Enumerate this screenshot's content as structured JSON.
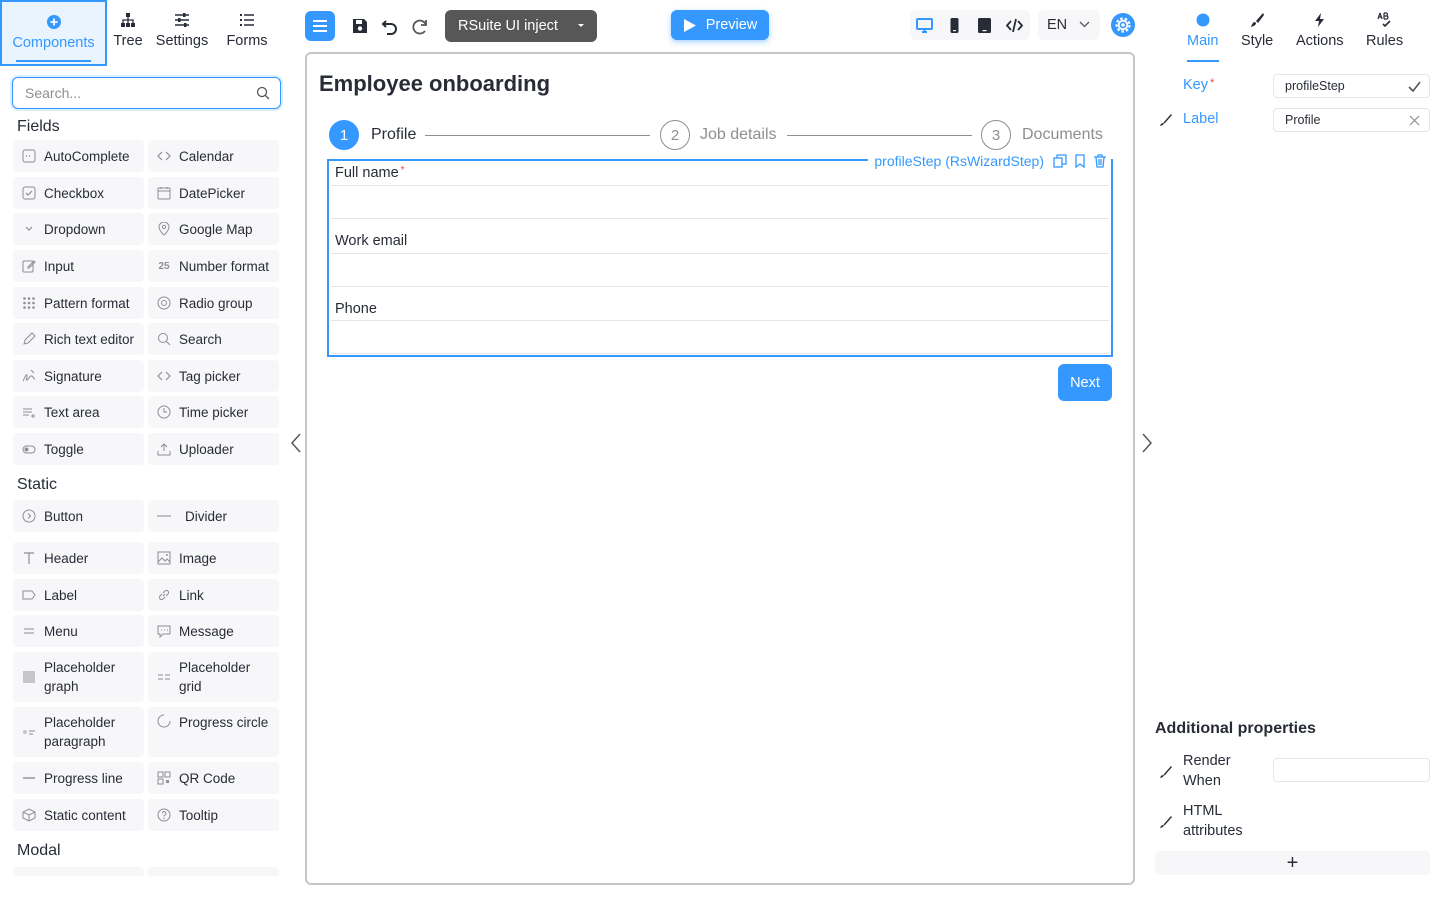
{
  "left_tabs": [
    {
      "label": "Components",
      "icon": "plus-circle-icon"
    },
    {
      "label": "Tree",
      "icon": "tree-icon"
    },
    {
      "label": "Settings",
      "icon": "sliders-icon"
    },
    {
      "label": "Forms",
      "icon": "list-icon"
    }
  ],
  "search": {
    "placeholder": "Search..."
  },
  "groups": {
    "fields": "Fields",
    "static": "Static",
    "modal": "Modal"
  },
  "fields": [
    "AutoComplete",
    "Calendar",
    "Checkbox",
    "DatePicker",
    "Dropdown",
    "Google Map",
    "Input",
    "Number format",
    "Pattern format",
    "Radio group",
    "Rich text editor",
    "Search",
    "Signature",
    "Tag picker",
    "Text area",
    "Time picker",
    "Toggle",
    "Uploader"
  ],
  "static_items": [
    "Button",
    "Divider",
    "Header",
    "Image",
    "Label",
    "Link",
    "Menu",
    "Message",
    "Placeholder graph",
    "Placeholder grid",
    "Placeholder paragraph",
    "Progress circle",
    "Progress line",
    "QR Code",
    "Static content",
    "Tooltip"
  ],
  "toolbar": {
    "theme": "RSuite UI inject",
    "preview": "Preview",
    "language": "EN"
  },
  "form": {
    "title": "Employee onboarding",
    "steps": [
      {
        "number": "1",
        "label": "Profile",
        "active": true
      },
      {
        "number": "2",
        "label": "Job details",
        "active": false
      },
      {
        "number": "3",
        "label": "Documents",
        "active": false
      }
    ],
    "selected_caption": "profileStep (RsWizardStep)",
    "fields": [
      {
        "label": "Full name",
        "required_mark": "*"
      },
      {
        "label": "Work email"
      },
      {
        "label": "Phone"
      }
    ],
    "next": "Next"
  },
  "right_tabs": [
    {
      "label": "Main",
      "icon": "dot-icon"
    },
    {
      "label": "Style",
      "icon": "brush-icon"
    },
    {
      "label": "Actions",
      "icon": "bolt-icon"
    },
    {
      "label": "Rules",
      "icon": "rules-icon"
    }
  ],
  "properties": {
    "key_label": "Key",
    "key_required": "*",
    "key_value": "profileStep",
    "label_label": "Label",
    "label_value": "Profile"
  },
  "additional": {
    "title": "Additional properties",
    "render_when": "Render When",
    "html_attributes": "HTML attributes",
    "add": "+"
  },
  "colors": {
    "accent": "#3498ff",
    "text": "#272c36",
    "muted": "#8e8e93",
    "surface": "#f7f7fa",
    "dark_button": "#575757",
    "required": "#f44336"
  }
}
